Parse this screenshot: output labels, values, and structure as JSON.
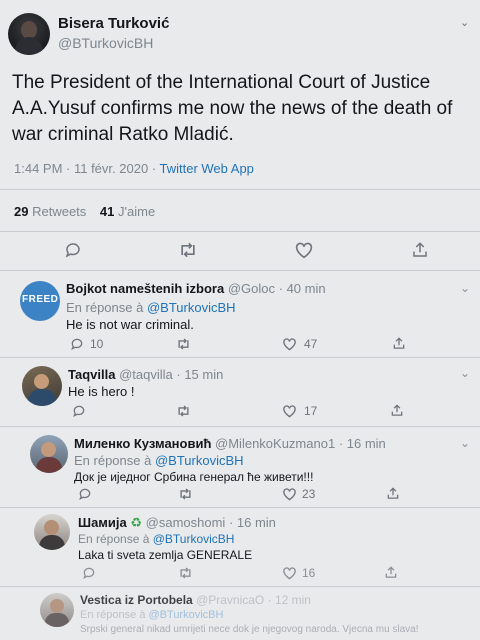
{
  "tweet": {
    "author_name": "Bisera Turković",
    "author_handle": "@BTurkovicBH",
    "text_line1": "The President of the International Court of Justice",
    "text_line2": "A.A.Yusuf confirms me now the news of the death of",
    "text_line3": "war criminal Ratko Mladić.",
    "time": "1:44 PM · 11 févr. 2020 · ",
    "source": "Twitter Web App",
    "retweets_count": "29",
    "retweets_label": "Retweets",
    "likes_count": "41",
    "likes_label": "J'aime"
  },
  "replies": [
    {
      "name": "Bojkot nameštenih izbora",
      "handle": "@Goloc",
      "time": "· 40 min",
      "reply_prefix": "En réponse à ",
      "reply_to": "@BTurkovicBH",
      "text": "He is not war criminal.",
      "reply_count": "10",
      "like_count": "47",
      "avatar_label": "FREED"
    },
    {
      "name": "Taqvilla",
      "handle": "@taqvilla",
      "time": "· 15 min",
      "text": "He is hero !",
      "like_count": "17"
    },
    {
      "name": "Миленко Кузмановић",
      "handle": "@MilenkoKuzmano1",
      "time": "· 16 min",
      "reply_prefix": "En réponse à ",
      "reply_to": "@BTurkovicBH",
      "text": "Док је иједног Србина генерал ће живети!!!",
      "like_count": "23"
    },
    {
      "name": "Шамија",
      "emoji": "♻",
      "handle": "@samoshomi",
      "time": "· 16 min",
      "reply_prefix": "En réponse à ",
      "reply_to": "@BTurkovicBH",
      "text": "Laka ti sveta zemlja GENERALE",
      "like_count": "16"
    },
    {
      "name": "Vestica iz Portobela",
      "handle": "@PravnicaO",
      "time": "· 12 min",
      "reply_prefix": "En réponse à ",
      "reply_to": "@BTurkovicBH",
      "text": "Srpski general nikad umrijeti nece dok je njegovog naroda. Vjecna mu slava!"
    }
  ],
  "colors": {
    "link": "#1f73b7",
    "muted": "#7d868f",
    "text": "#14171a"
  }
}
